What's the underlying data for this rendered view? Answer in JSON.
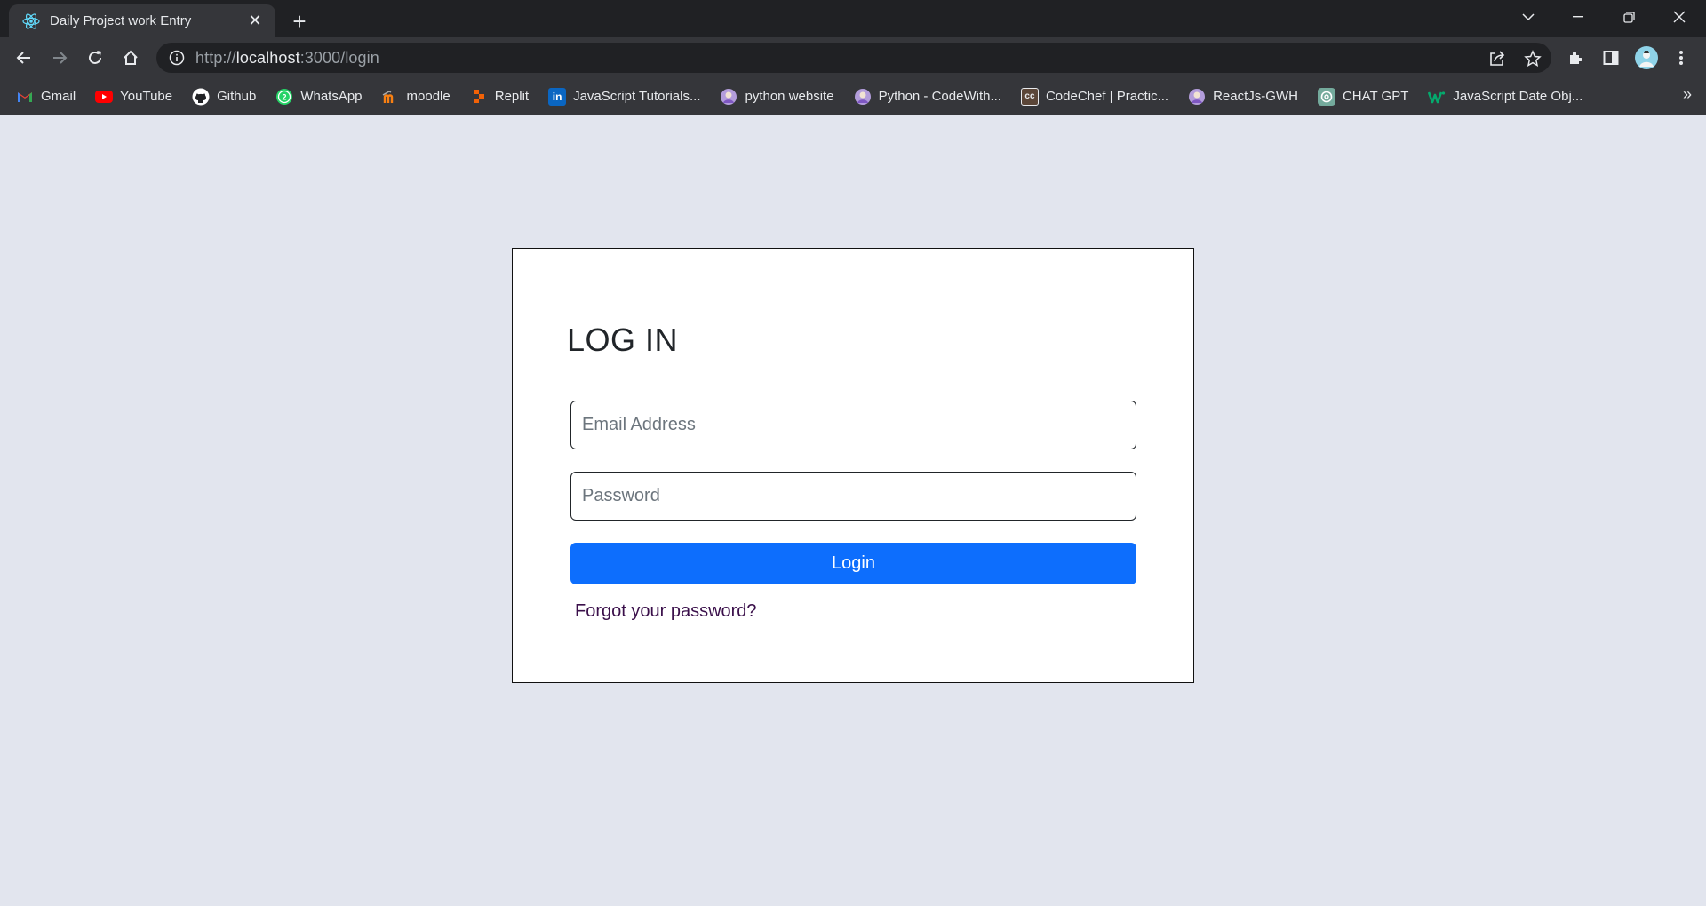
{
  "browser": {
    "tab_title": "Daily Project work Entry",
    "url_scheme": "http://",
    "url_host": "localhost",
    "url_rest": ":3000/login",
    "accent_color": "#0d6efd"
  },
  "bookmarks": [
    {
      "label": "Gmail",
      "icon": "gmail-icon"
    },
    {
      "label": "YouTube",
      "icon": "youtube-icon"
    },
    {
      "label": "Github",
      "icon": "github-icon"
    },
    {
      "label": "WhatsApp",
      "icon": "whatsapp-icon"
    },
    {
      "label": "moodle",
      "icon": "moodle-icon"
    },
    {
      "label": "Replit",
      "icon": "replit-icon"
    },
    {
      "label": "JavaScript Tutorials...",
      "icon": "linkedin-icon"
    },
    {
      "label": "python website",
      "icon": "avatar-icon"
    },
    {
      "label": "Python - CodeWith...",
      "icon": "avatar-icon"
    },
    {
      "label": "CodeChef | Practic...",
      "icon": "codechef-icon"
    },
    {
      "label": "ReactJs-GWH",
      "icon": "avatar-icon"
    },
    {
      "label": "CHAT GPT",
      "icon": "chatgpt-icon"
    },
    {
      "label": "JavaScript Date Obj...",
      "icon": "w3schools-icon"
    }
  ],
  "login": {
    "title": "LOG IN",
    "email_placeholder": "Email Address",
    "email_value": "",
    "password_placeholder": "Password",
    "password_value": "",
    "button_label": "Login",
    "forgot_label": "Forgot your password?"
  }
}
